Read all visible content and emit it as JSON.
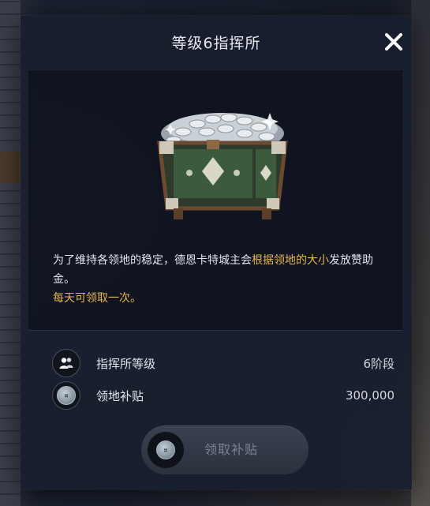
{
  "dialog": {
    "title": "等级6指挥所",
    "close_icon": "close-icon"
  },
  "reward": {
    "image": "silver-coin-chest",
    "description_part1": "为了维持各领地的稳定，德恩卡特城主会",
    "description_highlight": "根据领地的大小",
    "description_part2": "发放赞助金。",
    "daily_note": "每天可领取一次。"
  },
  "info_rows": [
    {
      "icon": "users-icon",
      "label": "指挥所等级",
      "value": "6阶段"
    },
    {
      "icon": "silver-coin-icon",
      "label": "领地补贴",
      "value": "300,000"
    }
  ],
  "claim_button": {
    "label": "领取补贴",
    "icon": "silver-coin-icon",
    "enabled": false
  },
  "colors": {
    "panel": "#181f2e",
    "highlight": "#e8b64a",
    "text": "#e3e6ec",
    "disabled_text": "#7c8290"
  }
}
